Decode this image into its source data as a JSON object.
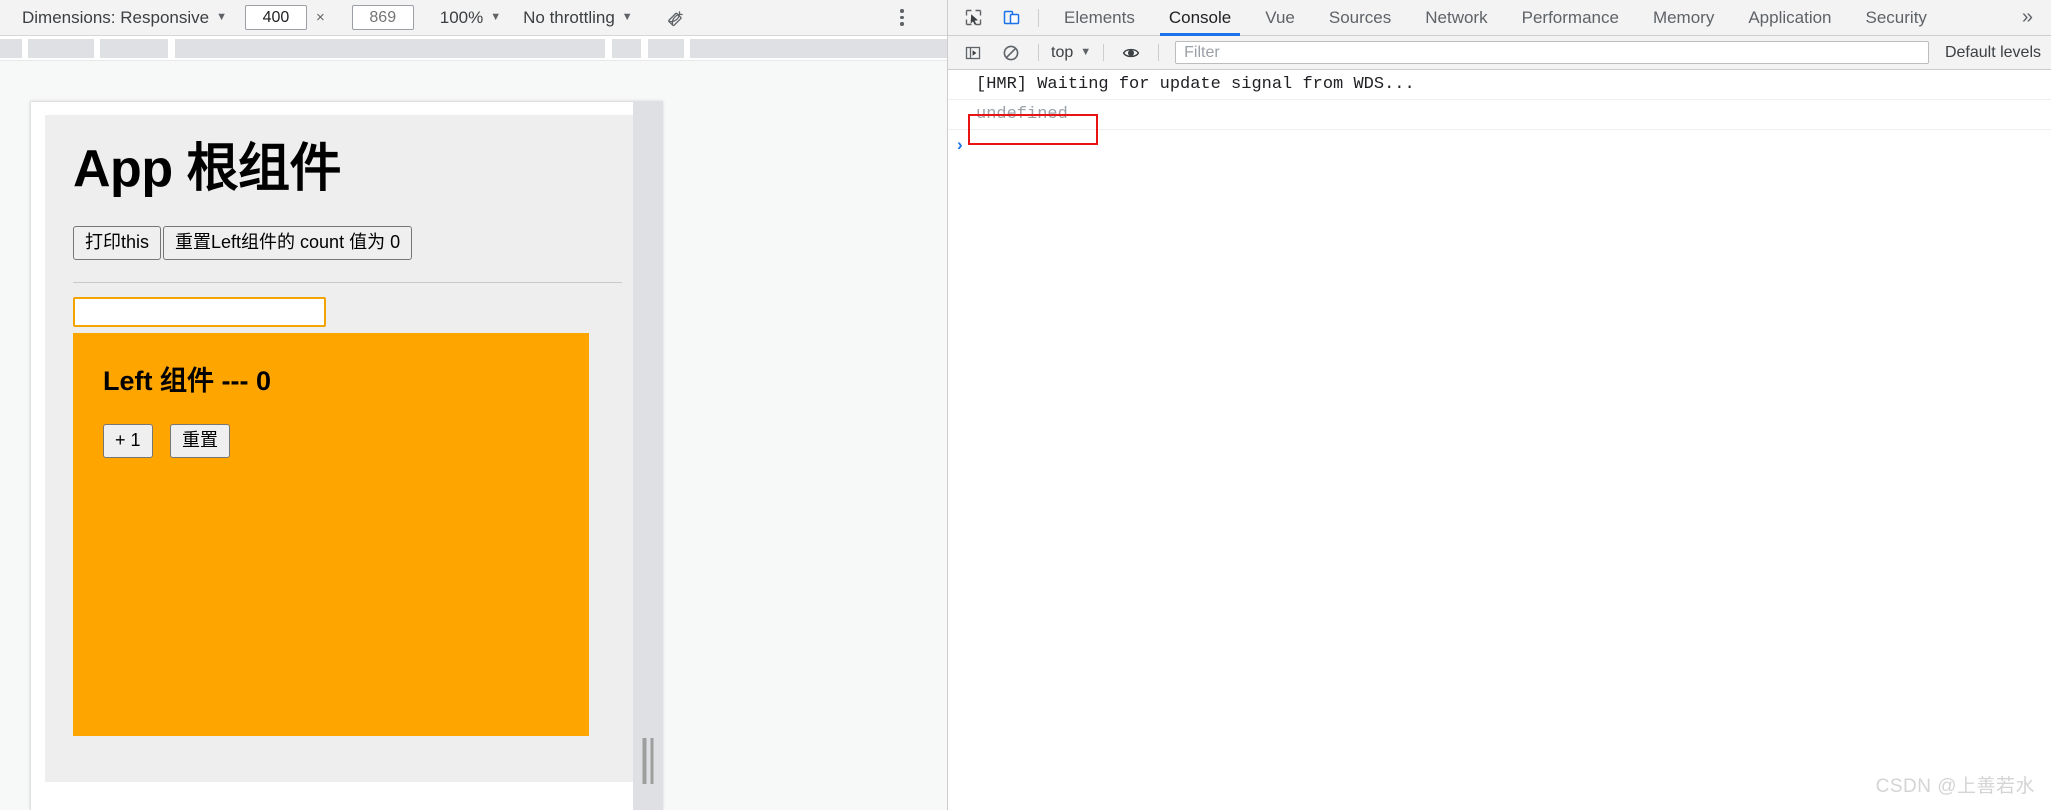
{
  "device_toolbar": {
    "dimensions_label": "Dimensions: Responsive",
    "width_value": "400",
    "height_value": "869",
    "height_placeholder": "869",
    "x_separator": "×",
    "zoom_label": "100%",
    "throttling_label": "No throttling",
    "rotate_icon": "rotate-device-icon",
    "more_options_icon": "kebab-menu-icon"
  },
  "emulated_page": {
    "title": "App 根组件",
    "buttons": [
      {
        "label": "打印this"
      },
      {
        "label": "重置Left组件的 count 值为 0"
      }
    ],
    "text_input": {
      "value": "",
      "placeholder": ""
    },
    "left_component": {
      "heading": "Left 组件 --- 0",
      "background_color": "#ffa500",
      "buttons": [
        {
          "label": "+ 1"
        },
        {
          "label": "重置"
        }
      ]
    }
  },
  "devtools": {
    "inspect_icon": "inspect-element-icon",
    "device_toggle_icon": "toggle-device-toolbar-icon",
    "tabs": [
      {
        "label": "Elements",
        "active": false
      },
      {
        "label": "Console",
        "active": true
      },
      {
        "label": "Vue",
        "active": false
      },
      {
        "label": "Sources",
        "active": false
      },
      {
        "label": "Network",
        "active": false
      },
      {
        "label": "Performance",
        "active": false
      },
      {
        "label": "Memory",
        "active": false
      },
      {
        "label": "Application",
        "active": false
      },
      {
        "label": "Security",
        "active": false
      }
    ],
    "more_tabs_icon": "chevron-double-right-icon",
    "console_toolbar": {
      "sidebar_toggle_icon": "console-sidebar-icon",
      "clear_icon": "clear-console-icon",
      "context_label": "top",
      "eye_icon": "live-expression-icon",
      "filter_placeholder": "Filter",
      "levels_label": "Default levels"
    },
    "console_messages": [
      {
        "text": "[HMR] Waiting for update signal from WDS...",
        "type": "info"
      },
      {
        "text": "undefined",
        "type": "result",
        "highlighted": true
      }
    ],
    "prompt_symbol": "›"
  },
  "watermark": "CSDN @上善若水",
  "colors": {
    "accent_blue": "#1a73e8",
    "orange_card": "#ffa500",
    "input_border_orange": "#f2a400",
    "annotation_red": "#e81313"
  }
}
